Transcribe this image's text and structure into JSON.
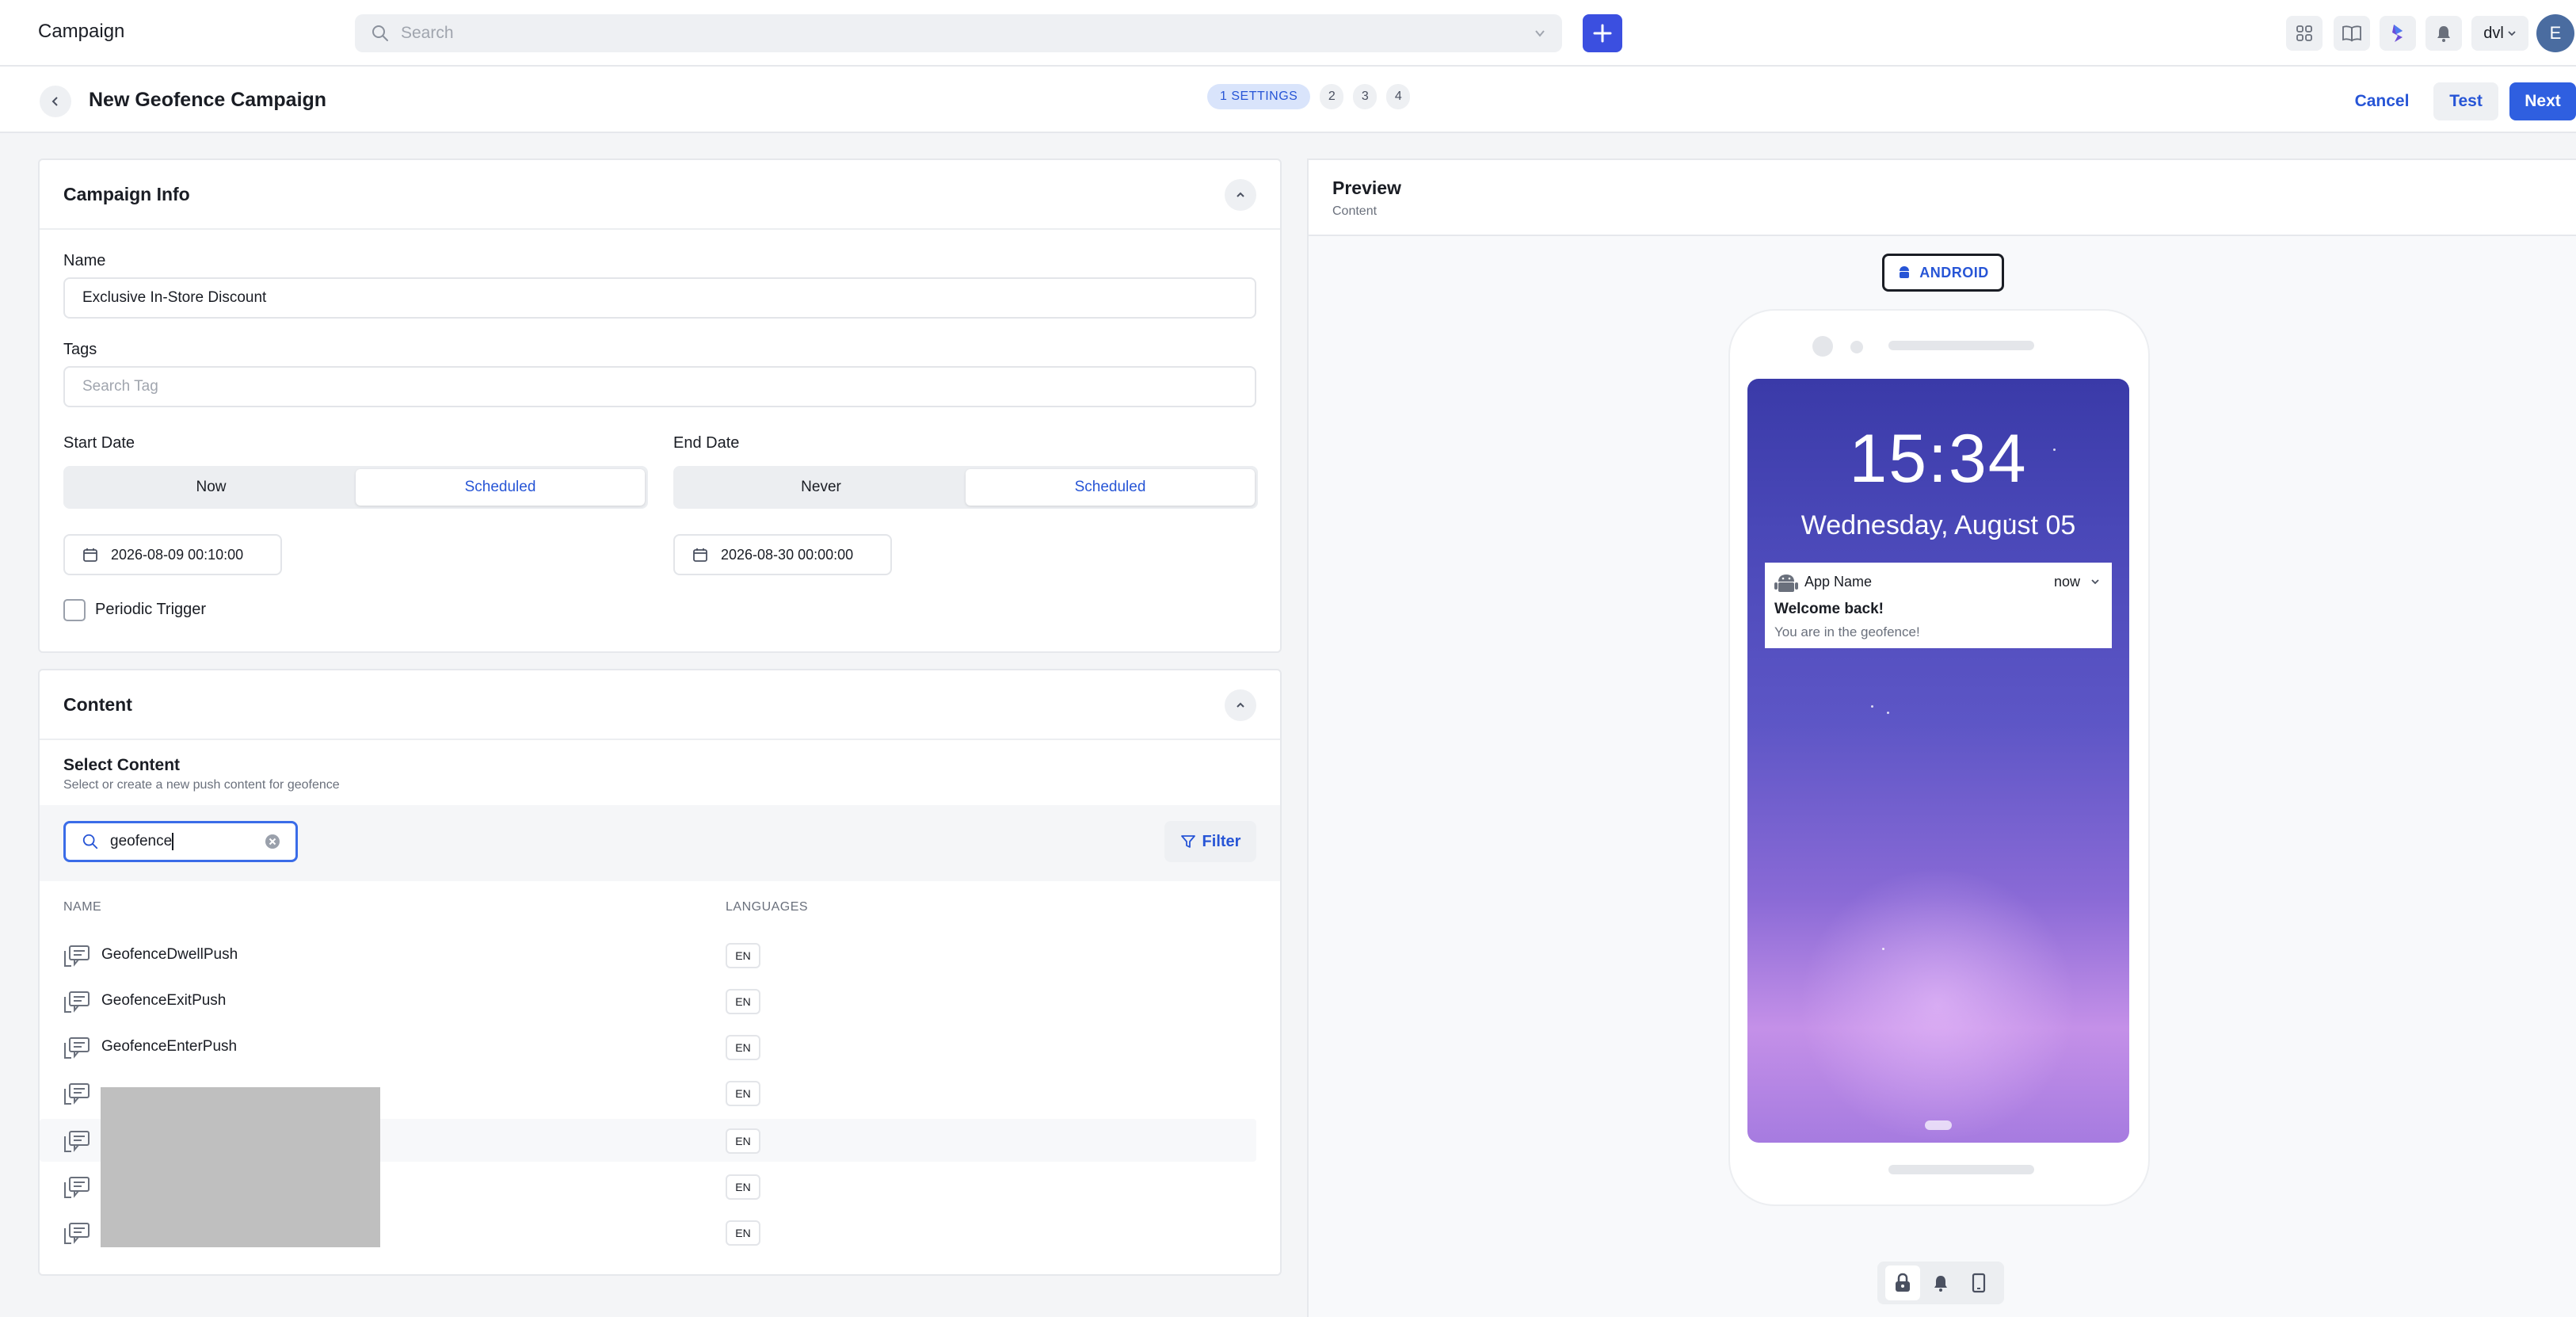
{
  "topbar": {
    "title": "Campaign",
    "search_placeholder": "Search",
    "org_label": "dvl",
    "avatar_initial": "E",
    "icons": [
      "grid-icon",
      "book-icon",
      "brand-icon",
      "bell-icon"
    ]
  },
  "header": {
    "title": "New Geofence Campaign",
    "steps": [
      "1 SETTINGS",
      "2",
      "3",
      "4"
    ],
    "active_step": 1,
    "cancel_label": "Cancel",
    "test_label": "Test",
    "next_label": "Next"
  },
  "campaign_info": {
    "title": "Campaign Info",
    "name_label": "Name",
    "name_value": "Exclusive In-Store Discount",
    "tags_label": "Tags",
    "tags_placeholder": "Search Tag",
    "start_date_label": "Start Date",
    "start_options": [
      "Now",
      "Scheduled"
    ],
    "start_selected": "Scheduled",
    "start_value": "2026-08-09 00:10:00",
    "end_date_label": "End Date",
    "end_options": [
      "Never",
      "Scheduled"
    ],
    "end_selected": "Scheduled",
    "end_value": "2026-08-30 00:00:00",
    "periodic_label": "Periodic Trigger",
    "periodic_checked": false
  },
  "content": {
    "title": "Content",
    "select_title": "Select Content",
    "select_desc": "Select or create a new push content for geofence",
    "search_value": "geofence",
    "filter_label": "Filter",
    "columns": [
      "NAME",
      "LANGUAGES"
    ],
    "rows": [
      {
        "name": "GeofenceDwellPush",
        "lang": "EN"
      },
      {
        "name": "GeofenceExitPush",
        "lang": "EN"
      },
      {
        "name": "GeofenceEnterPush",
        "lang": "EN"
      },
      {
        "name": "",
        "lang": "EN"
      },
      {
        "name": "",
        "lang": "EN"
      },
      {
        "name": "",
        "lang": "EN"
      },
      {
        "name": "",
        "lang": "EN"
      }
    ]
  },
  "preview": {
    "title": "Preview",
    "subtitle": "Content",
    "platform_label": "ANDROID",
    "clock": "15:34",
    "date": "Wednesday, August 05",
    "notification": {
      "app_name": "App Name",
      "time": "now",
      "title": "Welcome back!",
      "body": "You are in the geofence!"
    }
  },
  "colors": {
    "primary": "#2f5fe0",
    "accent_link": "#2755d6",
    "add_button": "#3b4fe0"
  }
}
